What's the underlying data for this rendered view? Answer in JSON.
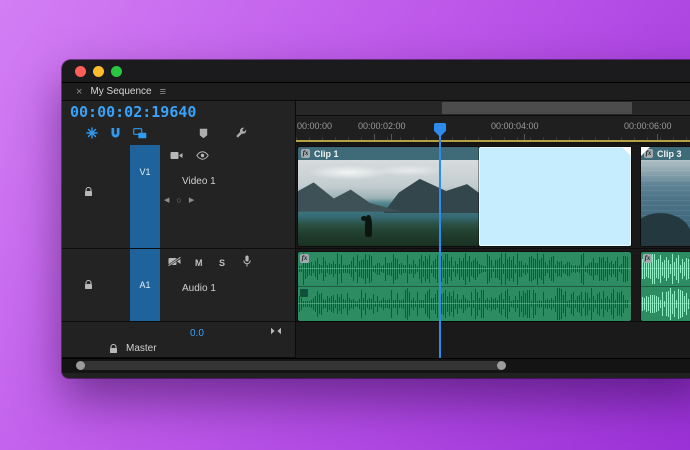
{
  "tab": {
    "close_glyph": "×",
    "title": "My Sequence",
    "menu_glyph": "≡"
  },
  "timecode": {
    "value": "00:00:02:19640"
  },
  "ruler": {
    "labels": [
      "00:00:00",
      "00:00:02:00",
      "00:00:04:00",
      "00:00:06:00"
    ]
  },
  "tracks": {
    "video": {
      "id": "V1",
      "name": "Video 1",
      "nav_prev": "◀",
      "nav_dot": "○",
      "nav_next": "▶"
    },
    "audio": {
      "id": "A1",
      "name": "Audio 1",
      "mute": "M",
      "solo": "S"
    },
    "master": {
      "name": "Master",
      "level": "0.0"
    }
  },
  "clips": {
    "clip1": {
      "label": "Clip 1",
      "fx_badge": "fx"
    },
    "clip2": {
      "label": ""
    },
    "clip3": {
      "label": "Clip 3",
      "fx_badge": "fx"
    },
    "audio1": {
      "fx_badge": "fx"
    },
    "audio3": {
      "fx_badge": "fx"
    }
  },
  "colors": {
    "accent_blue": "#2d8ceb",
    "timecode_blue": "#3aa2f8",
    "audio_clip_green": "#2e8c63",
    "selected_clip_blue": "#c6edfd",
    "work_area_yellow": "#b3a144",
    "track_target_blue": "#1e639c"
  }
}
